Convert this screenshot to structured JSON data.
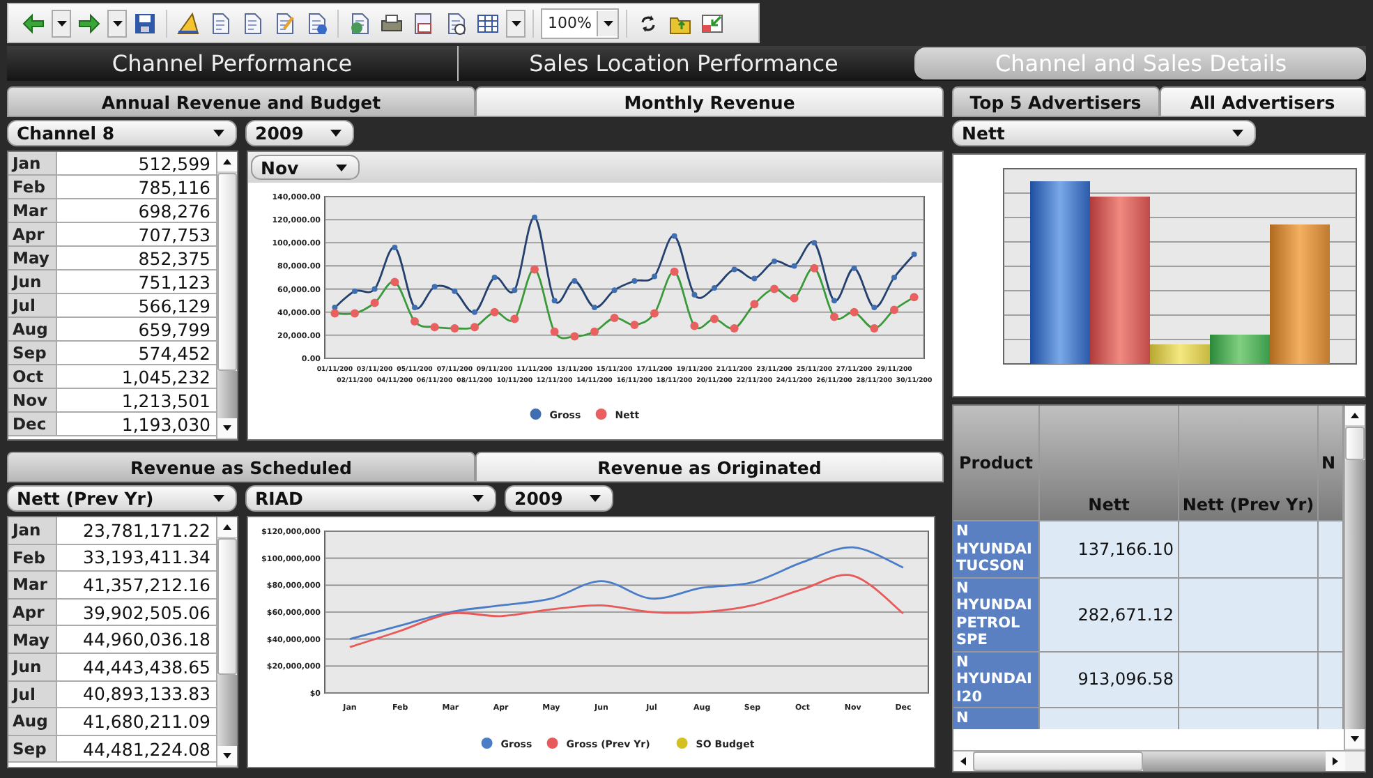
{
  "toolbar": {
    "zoom": "100%"
  },
  "main_tabs": [
    {
      "label": "Channel Performance",
      "selected": false
    },
    {
      "label": "Sales Location Performance",
      "selected": false
    },
    {
      "label": "Channel and Sales Details",
      "selected": true
    }
  ],
  "annual": {
    "tabs": [
      {
        "label": "Annual Revenue and Budget",
        "selected": true
      },
      {
        "label": "Monthly Revenue",
        "selected": false
      }
    ],
    "channel": "Channel 8",
    "year": "2009",
    "months": [
      {
        "month": "Jan",
        "value": "512,599"
      },
      {
        "month": "Feb",
        "value": "785,116"
      },
      {
        "month": "Mar",
        "value": "698,276"
      },
      {
        "month": "Apr",
        "value": "707,753"
      },
      {
        "month": "May",
        "value": "852,375"
      },
      {
        "month": "Jun",
        "value": "751,123"
      },
      {
        "month": "Jul",
        "value": "566,129"
      },
      {
        "month": "Aug",
        "value": "659,799"
      },
      {
        "month": "Sep",
        "value": "574,452"
      },
      {
        "month": "Oct",
        "value": "1,045,232"
      },
      {
        "month": "Nov",
        "value": "1,213,501"
      },
      {
        "month": "Dec",
        "value": "1,193,030"
      }
    ],
    "period": "Nov",
    "chart_data": {
      "type": "line",
      "grid": true,
      "legend": "bottom",
      "x": [
        "01/11/200",
        "02/11/200",
        "03/11/200",
        "04/11/200",
        "05/11/200",
        "06/11/200",
        "07/11/200",
        "08/11/200",
        "09/11/200",
        "10/11/200",
        "11/11/200",
        "12/11/200",
        "13/11/200",
        "14/11/200",
        "15/11/200",
        "16/11/200",
        "17/11/200",
        "18/11/200",
        "19/11/200",
        "20/11/200",
        "21/11/200",
        "22/11/200",
        "23/11/200",
        "24/11/200",
        "25/11/200",
        "26/11/200",
        "27/11/200",
        "28/11/200",
        "29/11/200",
        "30/11/200"
      ],
      "ylim": [
        0,
        140000
      ],
      "yticks": [
        {
          "value": 0,
          "label": "0.00"
        },
        {
          "value": 20000,
          "label": "20,000.00"
        },
        {
          "value": 40000,
          "label": "40,000.00"
        },
        {
          "value": 60000,
          "label": "60,000.00"
        },
        {
          "value": 80000,
          "label": "80,000.00"
        },
        {
          "value": 100000,
          "label": "100,000.00"
        },
        {
          "value": 120000,
          "label": "120,000.00"
        },
        {
          "value": 140000,
          "label": "140,000.00"
        }
      ],
      "series": [
        {
          "name": "Gross",
          "color": "#3f6fb0",
          "marker": "circle",
          "values": [
            44000,
            58000,
            60000,
            96000,
            44000,
            62000,
            58000,
            40000,
            70000,
            59000,
            122000,
            50000,
            67000,
            44000,
            59000,
            67000,
            71000,
            106000,
            55000,
            61000,
            77000,
            69000,
            84000,
            80000,
            100000,
            50000,
            78000,
            44000,
            70000,
            90000
          ]
        },
        {
          "name": "Nett",
          "color": "#e86060",
          "marker": "circle",
          "values": [
            39000,
            39000,
            48000,
            66000,
            32000,
            27000,
            26000,
            27000,
            40000,
            34000,
            77000,
            23000,
            19000,
            23000,
            35000,
            29000,
            39000,
            75000,
            28000,
            34000,
            26000,
            47000,
            60000,
            52000,
            78000,
            36000,
            40000,
            26000,
            42000,
            53000
          ]
        }
      ]
    }
  },
  "scheduled": {
    "tabs": [
      {
        "label": "Revenue as Scheduled",
        "selected": true
      },
      {
        "label": "Revenue as Originated",
        "selected": false
      }
    ],
    "measure": "Nett (Prev Yr)",
    "location": "RIAD",
    "year": "2009",
    "months": [
      {
        "month": "Jan",
        "value": "23,781,171.22"
      },
      {
        "month": "Feb",
        "value": "33,193,411.34"
      },
      {
        "month": "Mar",
        "value": "41,357,212.16"
      },
      {
        "month": "Apr",
        "value": "39,902,505.06"
      },
      {
        "month": "May",
        "value": "44,960,036.18"
      },
      {
        "month": "Jun",
        "value": "44,443,438.65"
      },
      {
        "month": "Jul",
        "value": "40,893,133.83"
      },
      {
        "month": "Aug",
        "value": "41,680,211.09"
      },
      {
        "month": "Sep",
        "value": "44,481,224.08"
      }
    ],
    "chart_data": {
      "type": "line",
      "grid": true,
      "legend": "bottom",
      "categories": [
        "Jan",
        "Feb",
        "Mar",
        "Apr",
        "May",
        "Jun",
        "Jul",
        "Aug",
        "Sep",
        "Oct",
        "Nov",
        "Dec"
      ],
      "ylim": [
        0,
        120000000
      ],
      "yticks": [
        {
          "value": 0,
          "label": "$0"
        },
        {
          "value": 20000000,
          "label": "$20,000,000"
        },
        {
          "value": 40000000,
          "label": "$40,000,000"
        },
        {
          "value": 60000000,
          "label": "$60,000,000"
        },
        {
          "value": 80000000,
          "label": "$80,000,000"
        },
        {
          "value": 100000000,
          "label": "$100,000,000"
        },
        {
          "value": 120000000,
          "label": "$120,000,000"
        }
      ],
      "series": [
        {
          "name": "Gross",
          "color": "#4a7cc8",
          "values": [
            40000000,
            50000000,
            60000000,
            65000000,
            70000000,
            83000000,
            70000000,
            78000000,
            82000000,
            97000000,
            108000000,
            93000000
          ]
        },
        {
          "name": "Gross (Prev Yr)",
          "color": "#e85a5a",
          "values": [
            34000000,
            46000000,
            59000000,
            57000000,
            62000000,
            65000000,
            60000000,
            60000000,
            65000000,
            77000000,
            87000000,
            59000000
          ]
        },
        {
          "name": "SO Budget",
          "color": "#d4c020",
          "values": [
            null,
            null,
            null,
            null,
            null,
            null,
            null,
            null,
            null,
            null,
            null,
            null
          ]
        }
      ]
    }
  },
  "advertisers": {
    "tabs": [
      {
        "label": "Top 5 Advertisers",
        "selected": true
      },
      {
        "label": "All Advertisers",
        "selected": false
      }
    ],
    "measure": "Nett",
    "table": {
      "columns": [
        "Product",
        "Nett",
        "Nett (Prev Yr)",
        "N"
      ],
      "rows": [
        {
          "cells": [
            "N HYUNDAI TUCSON",
            "137,166.10"
          ]
        },
        {
          "cells": [
            "N HYUNDAI PETROL SPE",
            "282,671.12"
          ]
        },
        {
          "cells": [
            "N HYUNDAI I20",
            "913,096.58"
          ]
        },
        {
          "cells": [
            "N"
          ]
        }
      ]
    }
  }
}
